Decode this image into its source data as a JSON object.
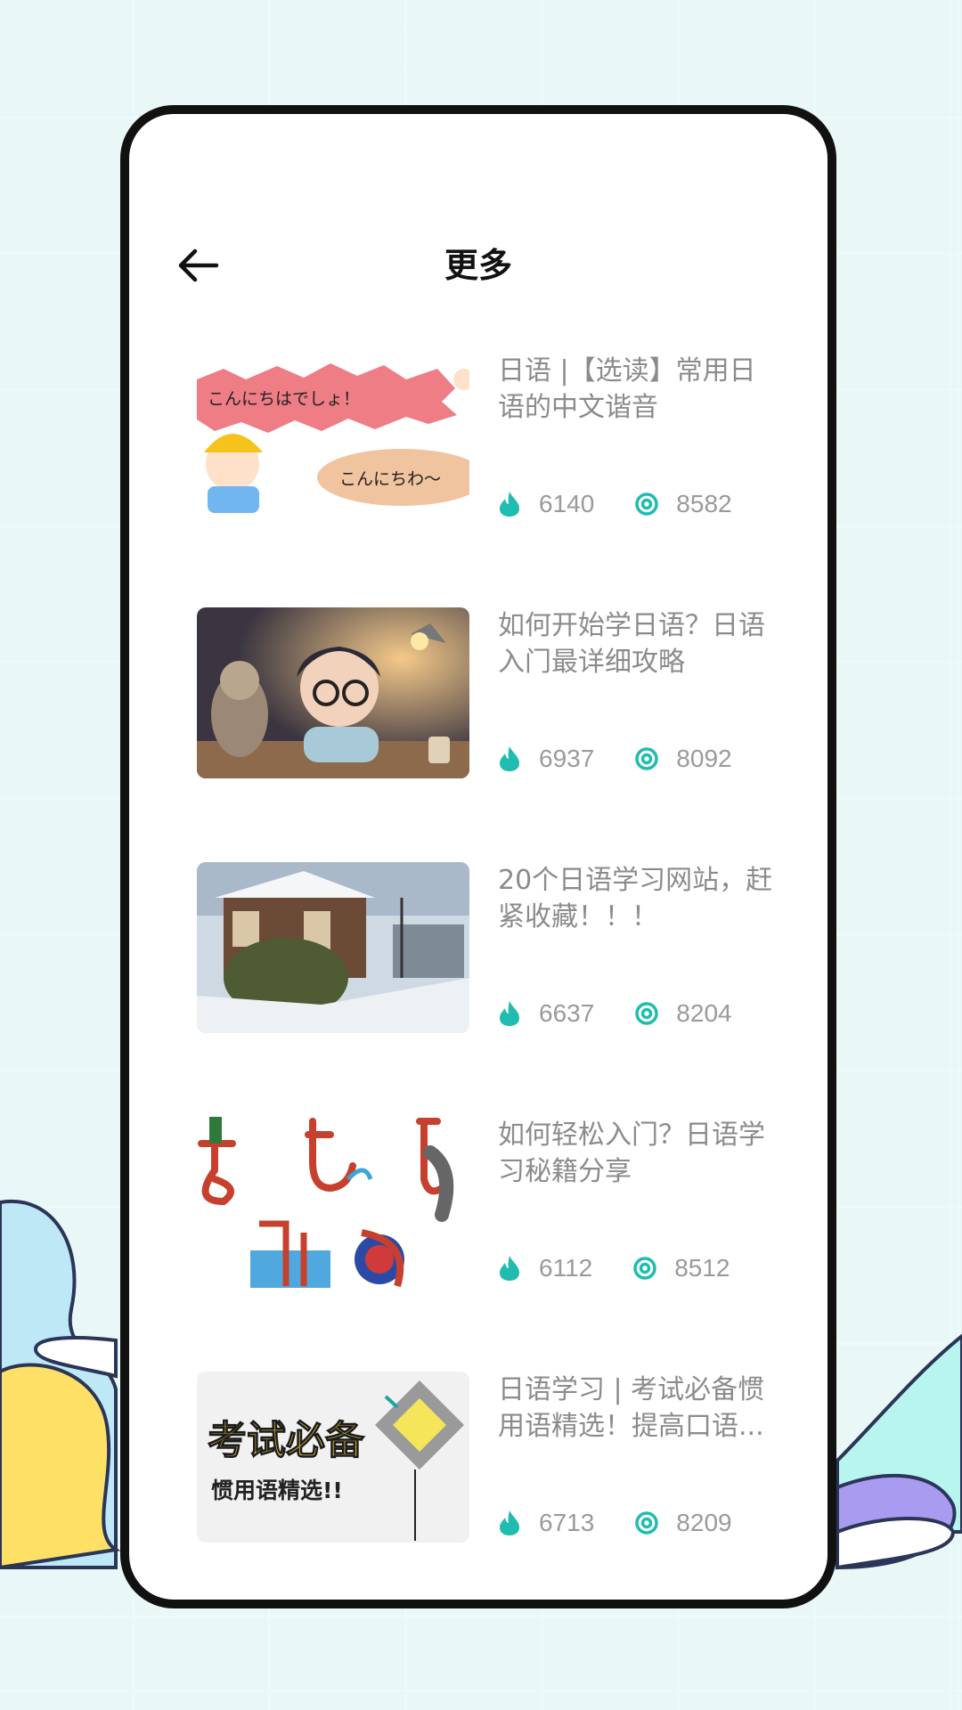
{
  "header": {
    "title": "更多",
    "back_icon": "back-arrow-icon"
  },
  "colors": {
    "accent": "#1fbcb0",
    "background": "#5bbfbf",
    "title_text": "#8b8b8b"
  },
  "articles": [
    {
      "title": "日语 |【选读】常用日语的中文谐音",
      "likes": "6140",
      "views": "8582",
      "thumb_texts": [
        "こんにちはでしょ！",
        "こんにちわ～"
      ]
    },
    {
      "title": "如何开始学日语？日语入门最详细攻略",
      "likes": "6937",
      "views": "8092"
    },
    {
      "title": "20个日语学习网站，赶紧收藏！！！",
      "likes": "6637",
      "views": "8204"
    },
    {
      "title": "如何轻松入门？日语学习秘籍分享",
      "likes": "6112",
      "views": "8512"
    },
    {
      "title": "日语学习 | 考试必备惯用语精选！提高口语...",
      "likes": "6713",
      "views": "8209",
      "thumb_texts": [
        "考试必备",
        "惯用语精选!!"
      ]
    }
  ]
}
